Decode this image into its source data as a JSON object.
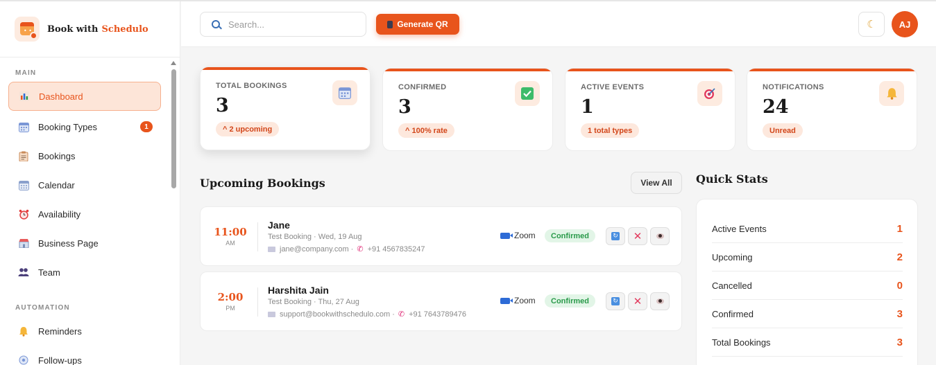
{
  "brand": {
    "name": "Book with",
    "accent": "Schedulo"
  },
  "sidebar": {
    "section_main": "MAIN",
    "section_automation": "AUTOMATION",
    "items": [
      {
        "label": "Dashboard",
        "icon": "bar-chart-icon",
        "active": true
      },
      {
        "label": "Booking Types",
        "icon": "calendar-grid-icon",
        "badge": "1"
      },
      {
        "label": "Bookings",
        "icon": "clipboard-icon"
      },
      {
        "label": "Calendar",
        "icon": "calendar-icon"
      },
      {
        "label": "Availability",
        "icon": "alarm-clock-icon"
      },
      {
        "label": "Business Page",
        "icon": "storefront-icon"
      },
      {
        "label": "Team",
        "icon": "people-icon"
      },
      {
        "label": "Reminders",
        "icon": "bell-icon"
      },
      {
        "label": "Follow-ups",
        "icon": "follow-up-icon"
      }
    ]
  },
  "header": {
    "search_placeholder": "Search...",
    "generate_qr": "Generate QR",
    "avatar_initials": "AJ"
  },
  "stats": [
    {
      "label": "TOTAL BOOKINGS",
      "value": "3",
      "pill": "^ 2 upcoming",
      "icon": "calendar-grid-icon"
    },
    {
      "label": "CONFIRMED",
      "value": "3",
      "pill": "^ 100% rate",
      "icon": "checkbox-icon"
    },
    {
      "label": "ACTIVE EVENTS",
      "value": "1",
      "pill": "1 total types",
      "icon": "target-icon"
    },
    {
      "label": "NOTIFICATIONS",
      "value": "24",
      "pill": "Unread",
      "icon": "bell-icon"
    }
  ],
  "upcoming": {
    "title": "Upcoming Bookings",
    "view_all": "View All",
    "bookings": [
      {
        "time": "11:00",
        "ampm": "AM",
        "name": "Jane",
        "sub": "Test Booking · Wed, 19 Aug",
        "email": "jane@company.com ·",
        "phone": "+91 4567835247",
        "platform": "Zoom",
        "status": "Confirmed"
      },
      {
        "time": "2:00",
        "ampm": "PM",
        "name": "Harshita Jain",
        "sub": "Test Booking · Thu, 27 Aug",
        "email": "support@bookwithschedulo.com ·",
        "phone": "+91 7643789476",
        "platform": "Zoom",
        "status": "Confirmed"
      }
    ]
  },
  "quick_stats": {
    "title": "Quick Stats",
    "rows": [
      {
        "label": "Active Events",
        "value": "1"
      },
      {
        "label": "Upcoming",
        "value": "2"
      },
      {
        "label": "Cancelled",
        "value": "0"
      },
      {
        "label": "Confirmed",
        "value": "3"
      },
      {
        "label": "Total Bookings",
        "value": "3"
      }
    ]
  },
  "colors": {
    "accent": "#e8541c",
    "success": "#2a9a4a",
    "danger": "#e23b5e"
  }
}
